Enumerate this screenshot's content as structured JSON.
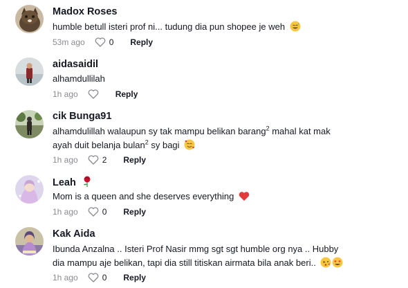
{
  "comments": [
    {
      "username": "Madox Roses",
      "text": "humble betull isteri prof ni... tudung dia pun shopee je weh",
      "time": "53m ago",
      "likes": "0",
      "reply_label": "Reply",
      "avatar_icon": "cat-avatar",
      "emoji": "sweat-smile-emoji"
    },
    {
      "username": "aidasaidil",
      "text": "alhamdullilah",
      "time": "1h ago",
      "likes": "",
      "reply_label": "Reply",
      "avatar_icon": "person-avatar"
    },
    {
      "username": "cik Bunga91",
      "text_parts": [
        "alhamdulillah walaupun sy tak mampu belikan barang",
        "2",
        " mahal kat mak ayah duit belanja bulan",
        "2",
        " sy bagi"
      ],
      "time": "1h ago",
      "likes": "2",
      "reply_label": "Reply",
      "avatar_icon": "outdoor-avatar",
      "emoji": "smiling-face-with-hearts-emoji"
    },
    {
      "username": "Leah",
      "text": "Mom is a queen and she deserves everything",
      "time": "1h ago",
      "likes": "0",
      "reply_label": "Reply",
      "avatar_icon": "girl-avatar",
      "name_emoji": "rose-emoji",
      "emoji": "red-heart-emoji"
    },
    {
      "username": "Kak Aida",
      "text": "Ibunda Anzalna .. Isteri Prof Nasir mmg sgt sgt humble org nya .. Hubby dia mampu aje belikan, tapi dia still titiskan airmata bila anak beri..",
      "time": "1h ago",
      "likes": "0",
      "reply_label": "Reply",
      "avatar_icon": "woman-avatar",
      "emoji": "kissing-and-heart-eyes-emoji"
    }
  ],
  "colors": {
    "text": "#161823",
    "meta": "#8a8b91",
    "heart": "#e23b3b"
  }
}
